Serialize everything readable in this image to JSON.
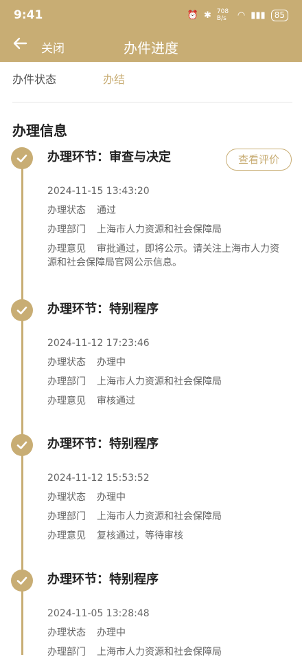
{
  "statusbar": {
    "time": "9:41",
    "icons": [
      "alarm-icon",
      "bluetooth-icon",
      "data-speed",
      "wifi-icon",
      "signal-icon"
    ],
    "data_speed": "708 B/s",
    "battery": "85"
  },
  "navbar": {
    "back_icon": "arrow-left-icon",
    "close_label": "关闭",
    "title": "办件进度"
  },
  "status": {
    "label": "办件状态",
    "value": "办结"
  },
  "section_title": "办理信息",
  "evaluate_label": "查看评价",
  "steps": [
    {
      "head": "办理环节：审查与决定",
      "time": "2024-11-15 13:43:20",
      "rows": [
        {
          "k": "办理状态",
          "v": "通过"
        },
        {
          "k": "办理部门",
          "v": "上海市人力资源和社会保障局"
        },
        {
          "k": "办理意见",
          "v": "审批通过，即将公示。请关注上海市人力资源和社会保障局官网公示信息。"
        }
      ]
    },
    {
      "head": "办理环节：特别程序",
      "time": "2024-11-12 17:23:46",
      "rows": [
        {
          "k": "办理状态",
          "v": "办理中"
        },
        {
          "k": "办理部门",
          "v": "上海市人力资源和社会保障局"
        },
        {
          "k": "办理意见",
          "v": "审核通过"
        }
      ]
    },
    {
      "head": "办理环节：特别程序",
      "time": "2024-11-12 15:53:52",
      "rows": [
        {
          "k": "办理状态",
          "v": "办理中"
        },
        {
          "k": "办理部门",
          "v": "上海市人力资源和社会保障局"
        },
        {
          "k": "办理意见",
          "v": "复核通过，等待审核"
        }
      ]
    },
    {
      "head": "办理环节：特别程序",
      "time": "2024-11-05 13:28:48",
      "rows": [
        {
          "k": "办理状态",
          "v": "办理中"
        },
        {
          "k": "办理部门",
          "v": "上海市人力资源和社会保障局"
        }
      ]
    }
  ],
  "colors": {
    "accent": "#c8ad74",
    "text": "#222222",
    "muted": "#666666"
  }
}
